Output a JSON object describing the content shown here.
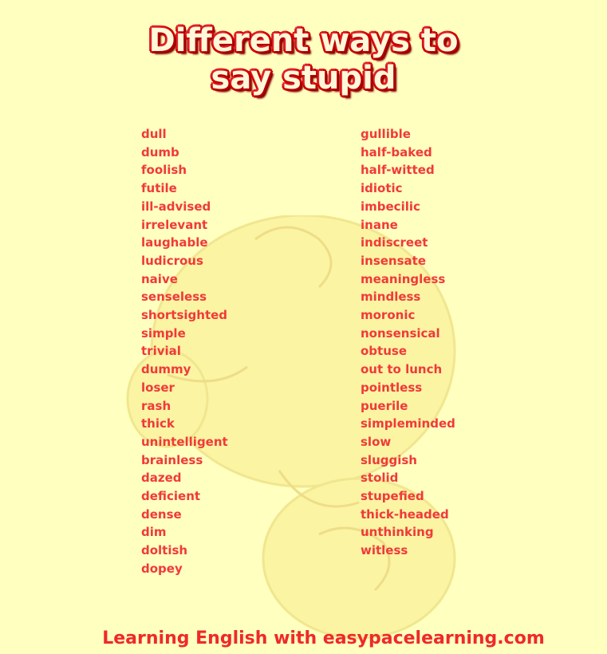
{
  "title": {
    "line1": "Different ways to",
    "line2": "say stupid"
  },
  "words_left": [
    "dull",
    "dumb",
    "foolish",
    "futile",
    "ill-advised",
    "irrelevant",
    "laughable",
    "ludicrous",
    "naive",
    "senseless",
    "shortsighted",
    "simple",
    "trivial",
    "dummy",
    "loser",
    "rash",
    "thick",
    "unintelligent",
    "brainless",
    "dazed",
    "deficient",
    "dense",
    "dim",
    "doltish",
    "dopey"
  ],
  "words_right": [
    "gullible",
    "half-baked",
    "half-witted",
    "idiotic",
    "imbecilic",
    "inane",
    "indiscreet",
    "insensate",
    "meaningless",
    "mindless",
    "moronic",
    "nonsensical",
    "obtuse",
    "out to lunch",
    "pointless",
    "puerile",
    "simpleminded",
    "slow",
    "sluggish",
    "stolid",
    "stupefied",
    "thick-headed",
    "unthinking",
    "witless"
  ],
  "footer": "Learning English with easypacelearning.com",
  "colors": {
    "background": "#ffffc0",
    "word": "#f03a3a",
    "title_fill": "#fff8d8",
    "title_outline": "#c00000"
  }
}
